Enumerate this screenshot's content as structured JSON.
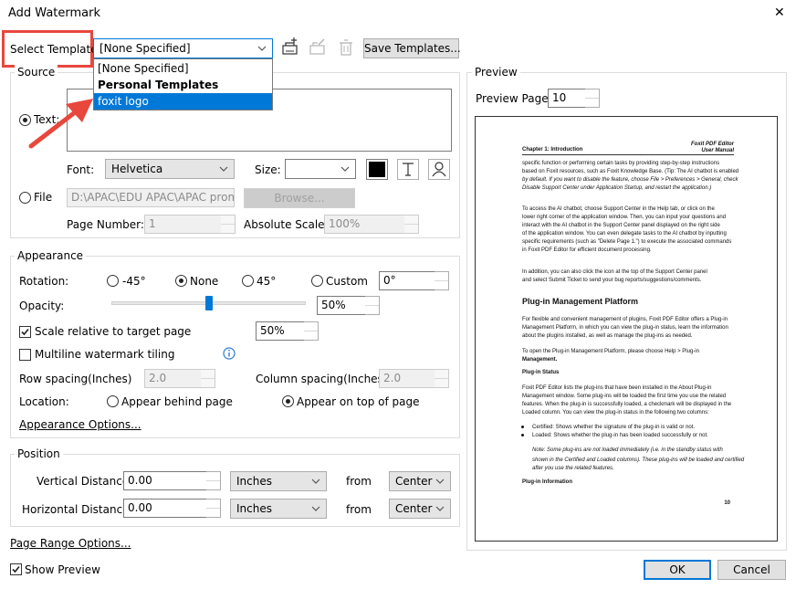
{
  "dialog": {
    "title": "Add Watermark",
    "close": "✕"
  },
  "template": {
    "label": "Select Template:",
    "value": "[None Specified]",
    "save_button": "Save Templates...",
    "dropdown": [
      "[None Specified]",
      "Personal Templates",
      "foxit logo"
    ]
  },
  "source": {
    "group_label": "Source",
    "text_label": "Text:",
    "text_value": "",
    "font_label": "Font:",
    "font_value": "Helvetica",
    "size_label": "Size:",
    "size_value": "",
    "file_label": "File",
    "file_path": "D:\\APAC\\EDU APAC\\APAC promo",
    "browse_button": "Browse...",
    "page_number_label": "Page Number:",
    "page_number_value": "1",
    "abs_scale_label": "Absolute Scale:",
    "abs_scale_value": "100%",
    "text_color": "#000000"
  },
  "appearance": {
    "group_label": "Appearance",
    "rotation_label": "Rotation:",
    "rot_m45": "-45°",
    "rot_none": "None",
    "rot_45": "45°",
    "rot_custom": "Custom",
    "custom_value": "0°",
    "opacity_label": "Opacity:",
    "opacity_value": "50%",
    "opacity_fraction": 0.5,
    "scale_label": "Scale relative to target page",
    "scale_value": "50%",
    "tiling_label": "Multiline watermark tiling",
    "row_spacing_label": "Row spacing(Inches)",
    "row_spacing_value": "2.0",
    "col_spacing_label": "Column spacing(Inches)",
    "col_spacing_value": "2.0",
    "location_label": "Location:",
    "loc_behind": "Appear behind page",
    "loc_top": "Appear on top of page",
    "options_link": "Appearance Options..."
  },
  "position": {
    "group_label": "Position",
    "vertical_label": "Vertical Distance:",
    "vertical_value": "0.00",
    "vertical_unit": "Inches",
    "vertical_from_label": "from",
    "vertical_from": "Center",
    "horizontal_label": "Horizontal Distance:",
    "horizontal_value": "0.00",
    "horizontal_unit": "Inches",
    "horizontal_from_label": "from",
    "horizontal_from": "Center"
  },
  "page_range_link": "Page Range Options...",
  "show_preview_label": "Show Preview",
  "ok_button": "OK",
  "cancel_button": "Cancel",
  "preview": {
    "group_label": "Preview",
    "page_label": "Preview Page:",
    "page_value": "10",
    "doc": {
      "header_right_1": "Foxit PDF Editor",
      "header_right_2": "User Manual",
      "chapter": "Chapter 1: Introduction",
      "p1": [
        "specific function or performing certain tasks by providing step-by-step instructions",
        "based on Foxit resources, such as Foxit Knowledge Base. (Tip: The AI chatbot is enabled",
        "by default. If you want to disable the feature, choose File > Preferences > General, check",
        "Disable Support Center under Application Startup, and restart the application.)"
      ],
      "p2": [
        "To access the AI chatbot, choose Support Center in the Help tab, or click      on the",
        "lower right corner of the application window. Then, you can input your questions and",
        "interact with the AI chatbot in the Support Center panel displayed on the right side",
        "of the application window. You can even delegate tasks to the AI chatbot by inputting",
        "specific requirements (such as \"Delete Page 1.\") to execute the associated commands",
        "in Foxit PDF Editor for efficient document processing."
      ],
      "p3": [
        "In addition, you can also click the      icon at the top of the Support Center panel",
        "and select Submit Ticket to send your bug reports/suggestions/comments."
      ],
      "h2": "Plug-in Management Platform",
      "p4": [
        "For flexible and convenient management of plugins, Foxit PDF Editor offers a Plug-in",
        "Management Platform, in which you can view the plug-in status, learn the information",
        "about the plugins installed, as well as manage the plug-ins as needed."
      ],
      "p5": [
        "To open the Plug-in Management Platform, please choose Help > Plug-in",
        "Management."
      ],
      "h3a": "Plug-in Status",
      "p6": [
        "Foxit PDF Editor lists the plug-ins that have been installed in the About Plug-in",
        "Management window. Some plug-ins will be loaded the first time you use the related",
        "features. When the plug-in is successfully loaded, a checkmark will be displayed in the",
        "Loaded column. You can view the plug-in status in the following two columns:"
      ],
      "b1": "Certified: Shows whether the signature of the plug-in is valid or not.",
      "b2": "Loaded: Shows whether the plug-in has been loaded successfully or not.",
      "note": [
        "Note: Some plug-ins are not loaded immediately (i.e. in the standby status with",
        "shown in the Certified and Loaded columns). These plug-ins will be loaded and certified",
        "after you use the related features."
      ],
      "h3b": "Plug-in Information",
      "page_num": "10"
    }
  },
  "accent": "#0078d7",
  "highlight": "#e8473c"
}
